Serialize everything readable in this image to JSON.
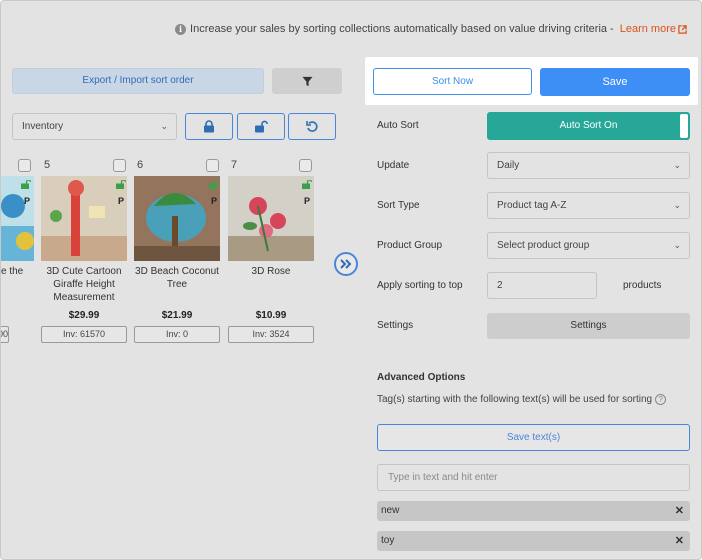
{
  "info": {
    "text": "Increase your sales by sorting collections automatically based on value driving criteria -",
    "link": "Learn more"
  },
  "toolbar": {
    "export_label": "Export / Import sort order",
    "sort_now_label": "Sort Now",
    "save_label": "Save",
    "inventory_select": "Inventory"
  },
  "products": [
    {
      "num": "",
      "title": "e the",
      "price": "",
      "inv": "00"
    },
    {
      "num": "5",
      "title": "3D Cute Cartoon Giraffe Height Measurement",
      "price": "$29.99",
      "inv": "Inv: 61570"
    },
    {
      "num": "6",
      "title": "3D Beach Coconut Tree",
      "price": "$21.99",
      "inv": "Inv: 0"
    },
    {
      "num": "7",
      "title": "3D Rose",
      "price": "$10.99",
      "inv": "Inv: 3524"
    }
  ],
  "product_badge": "P",
  "form": {
    "auto_sort_label": "Auto Sort",
    "auto_sort_value": "Auto Sort On",
    "update_label": "Update",
    "update_value": "Daily",
    "sort_type_label": "Sort Type",
    "sort_type_value": "Product tag A-Z",
    "product_group_label": "Product Group",
    "product_group_value": "Select product group",
    "apply_top_label": "Apply sorting to top",
    "apply_top_value": "2",
    "apply_top_unit": "products",
    "settings_label": "Settings",
    "settings_button": "Settings"
  },
  "advanced": {
    "title": "Advanced Options",
    "description": "Tag(s) starting with the following text(s) will be used for sorting",
    "save_text_button": "Save text(s)",
    "tag_input_placeholder": "Type in text and hit enter",
    "tags": [
      "new",
      "toy"
    ]
  },
  "colors": {
    "primary": "#3d8ff5",
    "toggle_on": "#27a797",
    "link": "#d9531e",
    "lock_green": "#3aa04a"
  }
}
